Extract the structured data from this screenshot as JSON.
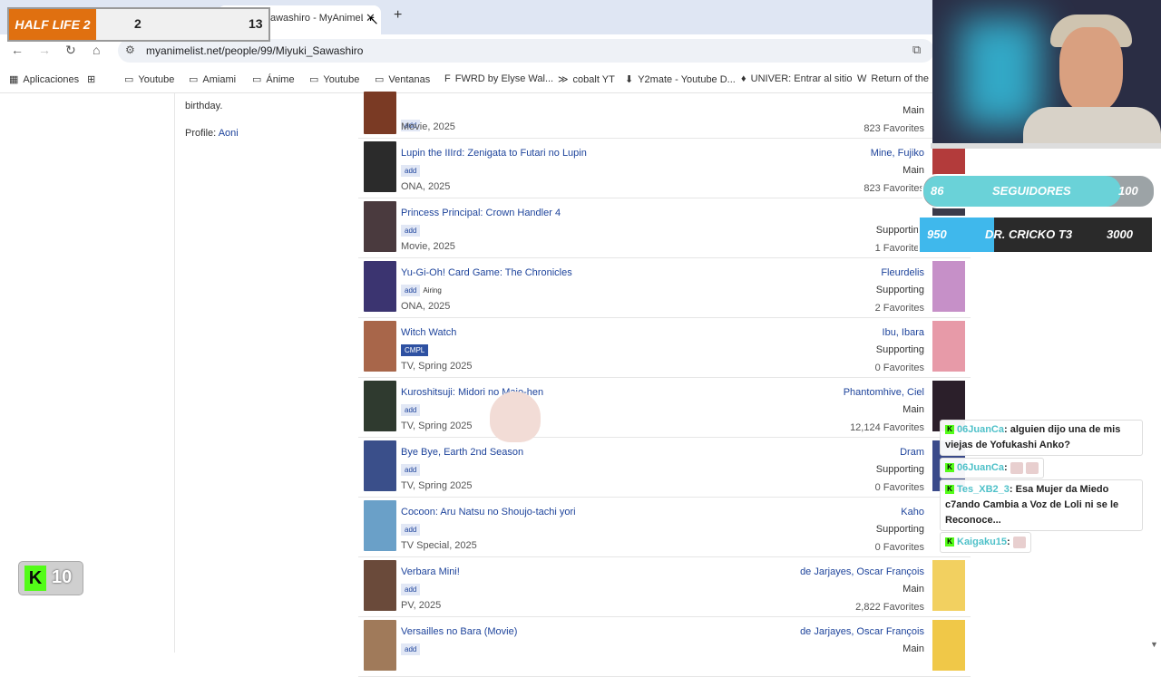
{
  "browser": {
    "tab_title": "awashiro - MyAnimeLis",
    "url": "myanimelist.net/people/99/Miyuki_Sawashiro",
    "bookmarks": [
      {
        "label": "Aplicaciones",
        "icon": "apps-grid-icon"
      },
      {
        "label": "",
        "icon": "grid-icon"
      },
      {
        "label": "Youtube",
        "icon": "folder-icon"
      },
      {
        "label": "Amiami",
        "icon": "folder-icon"
      },
      {
        "label": "Ánime",
        "icon": "folder-icon"
      },
      {
        "label": "Youtube",
        "icon": "folder-icon"
      },
      {
        "label": "Ventanas",
        "icon": "folder-icon"
      },
      {
        "label": "FWRD by Elyse Wal...",
        "icon": "f-icon"
      },
      {
        "label": "cobalt YT",
        "icon": "cobalt-icon"
      },
      {
        "label": "Y2mate - Youtube D...",
        "icon": "download-icon"
      },
      {
        "label": "UNIVER: Entrar al sitio",
        "icon": "univer-icon"
      },
      {
        "label": "Return of the",
        "icon": "w-icon"
      }
    ]
  },
  "sidebar": {
    "birthday": "birthday.",
    "profile_label": "Profile:",
    "profile_link": "Aoni"
  },
  "roles": [
    {
      "title": "",
      "tag": "add",
      "status": "",
      "meta": "Movie, 2025",
      "character": "",
      "role": "Main",
      "favorites": "823 Favorites",
      "thumb": "#7a3a24",
      "charimg": ""
    },
    {
      "title": "Lupin the IIIrd: Zenigata to Futari no Lupin",
      "tag": "add",
      "status": "",
      "meta": "ONA, 2025",
      "character": "Mine, Fujiko",
      "role": "Main",
      "favorites": "823 Favorites",
      "thumb": "#2b2b2b",
      "charimg": "#b33b3b"
    },
    {
      "title": "Princess Principal: Crown Handler 4",
      "tag": "add",
      "status": "",
      "meta": "Movie, 2025",
      "character": "",
      "role": "Supporting",
      "favorites": "1 Favorites",
      "thumb": "#4a3a3e",
      "charimg": "#3a3a4a"
    },
    {
      "title": "Yu-Gi-Oh! Card Game: The Chronicles",
      "tag": "add",
      "status": "Airing",
      "meta": "ONA, 2025",
      "character": "Fleurdelis",
      "role": "Supporting",
      "favorites": "2 Favorites",
      "thumb": "#3b3470",
      "charimg": "#c690c8"
    },
    {
      "title": "Witch Watch",
      "tag": "CMPL",
      "status": "",
      "meta": "TV, Spring 2025",
      "character": "Ibu, Ibara",
      "role": "Supporting",
      "favorites": "0 Favorites",
      "thumb": "#a8664a",
      "charimg": "#e79aa8"
    },
    {
      "title": "Kuroshitsuji: Midori no Majo-hen",
      "tag": "add",
      "status": "",
      "meta": "TV, Spring 2025",
      "character": "Phantomhive, Ciel",
      "role": "Main",
      "favorites": "12,124 Favorites",
      "thumb": "#2f3a2f",
      "charimg": "#2b1f2a"
    },
    {
      "title": "Bye Bye, Earth 2nd Season",
      "tag": "add",
      "status": "",
      "meta": "TV, Spring 2025",
      "character": "Dram",
      "role": "Supporting",
      "favorites": "0 Favorites",
      "thumb": "#3a4f8a",
      "charimg": "#3a4a8a"
    },
    {
      "title": "Cocoon: Aru Natsu no Shoujo-tachi yori",
      "tag": "add",
      "status": "",
      "meta": "TV Special, 2025",
      "character": "Kaho",
      "role": "Supporting",
      "favorites": "0 Favorites",
      "thumb": "#6aa0c8",
      "charimg": ""
    },
    {
      "title": "Verbara Mini!",
      "tag": "add",
      "status": "",
      "meta": "PV, 2025",
      "character": "de Jarjayes, Oscar François",
      "role": "Main",
      "favorites": "2,822 Favorites",
      "thumb": "#6a4a3a",
      "charimg": "#f2d060"
    },
    {
      "title": "Versailles no Bara (Movie)",
      "tag": "add",
      "status": "",
      "meta": "",
      "character": "de Jarjayes, Oscar François",
      "role": "Main",
      "favorites": "",
      "thumb": "#a07a5a",
      "charimg": "#f0c848"
    }
  ],
  "overlay": {
    "game_title": "HALF LIFE 2",
    "game_count": "2",
    "game_total": "13",
    "followers_current": "86",
    "followers_label": "SEGUIDORES",
    "followers_goal": "100",
    "followers_progress": 0.86,
    "goal2_current": "950",
    "goal2_label": "DR. CRICKO T3",
    "goal2_goal": "3000",
    "goal2_progress": 0.32,
    "kick_count": "10",
    "chat": [
      {
        "user": "06JuanCa",
        "text": ": alguien dijo una de mis viejas de Yofukashi Anko?"
      },
      {
        "user": "06JuanCa",
        "text": ":"
      },
      {
        "user": "Tes_XB2_3",
        "text": ": Esa Mujer da Miedo c7ando Cambia a Voz de Loli ni se le Reconoce..."
      },
      {
        "user": "Kaigaku15",
        "text": ":"
      }
    ]
  }
}
